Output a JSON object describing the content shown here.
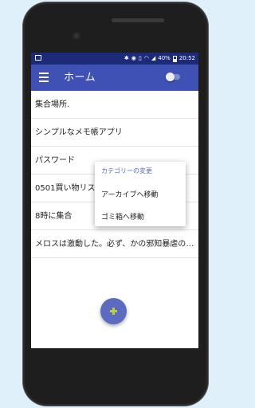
{
  "statusbar": {
    "battery": "40%",
    "time": "20:52"
  },
  "appbar": {
    "title": "ホーム"
  },
  "memos": [
    {
      "title": "集合場所."
    },
    {
      "title": "シンプルなメモ帳アプリ"
    },
    {
      "title": "パスワード"
    },
    {
      "title": "0501買い物リスト"
    },
    {
      "title": "8時に集合"
    },
    {
      "title": "メロスは激動した。必ず、かの邪知暴虐の王を除かなければならぬと決意した。"
    }
  ],
  "context_menu": {
    "header": "カテゴリーの変更",
    "items": [
      "アーカイブへ移動",
      "ゴミ箱へ移動"
    ]
  },
  "fab": {
    "icon": "plus-icon"
  },
  "colors": {
    "statusbar": "#1d2a78",
    "appbar": "#3f51b5",
    "menu_header": "#5c6bc0",
    "fab": "#5c6bc0",
    "fab_icon": "#b8d33f",
    "background": "#dff0fa"
  }
}
